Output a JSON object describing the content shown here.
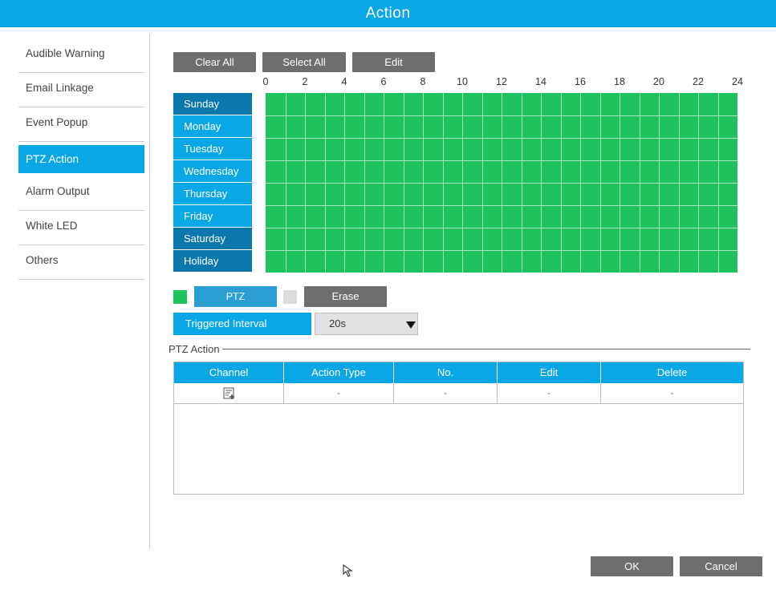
{
  "window": {
    "title": "Action"
  },
  "sidebar": {
    "items": [
      {
        "label": "Audible Warning",
        "active": false
      },
      {
        "label": "Email Linkage",
        "active": false
      },
      {
        "label": "Event Popup",
        "active": false
      },
      {
        "label": "PTZ Action",
        "active": true
      },
      {
        "label": "Alarm Output",
        "active": false
      },
      {
        "label": "White LED",
        "active": false
      },
      {
        "label": "Others",
        "active": false
      }
    ]
  },
  "schedule": {
    "toolbar": {
      "clear_all": "Clear All",
      "select_all": "Select All",
      "edit": "Edit"
    },
    "hour_labels": [
      "0",
      "2",
      "4",
      "6",
      "8",
      "10",
      "12",
      "14",
      "16",
      "18",
      "20",
      "22",
      "24"
    ],
    "days": [
      "Sunday",
      "Monday",
      "Tuesday",
      "Wednesday",
      "Thursday",
      "Friday",
      "Saturday",
      "Holiday"
    ],
    "all_hours_scheduled": true,
    "scheduled_color": "#1fc35e",
    "legend": {
      "ptz_label": "PTZ",
      "erase_label": "Erase",
      "ptz_color": "#1fc35e",
      "erase_color": "#dcdcdc"
    }
  },
  "triggered_interval": {
    "label": "Triggered Interval",
    "value": "20s"
  },
  "ptz_action": {
    "section_title": "PTZ Action",
    "columns": [
      "Channel",
      "Action Type",
      "No.",
      "Edit",
      "Delete"
    ],
    "rows": [
      {
        "channel_icon": "add-list-icon",
        "action_type": "-",
        "no": "-",
        "edit": "-",
        "delete": "-"
      }
    ]
  },
  "footer": {
    "ok": "OK",
    "cancel": "Cancel"
  },
  "colors": {
    "accent": "#0aa7e6",
    "accent_dark": "#0a78ad",
    "button_gray": "#6e6e6e"
  }
}
